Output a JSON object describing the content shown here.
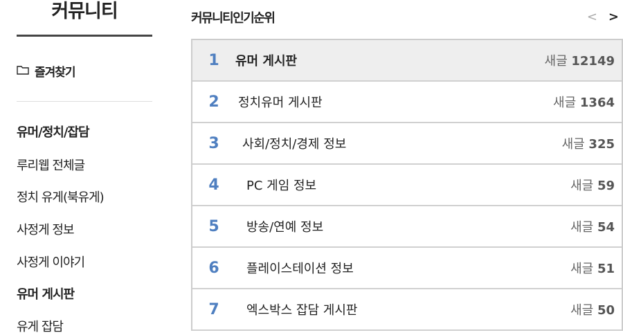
{
  "sidebar": {
    "title": "커뮤니티",
    "favorites_label": "즐겨찾기",
    "items": [
      {
        "label": "유머/정치/잡담",
        "bold": true
      },
      {
        "label": "루리웹 전체글",
        "bold": false
      },
      {
        "label": "정치 유게(북유게)",
        "bold": false
      },
      {
        "label": "사정게 정보",
        "bold": false
      },
      {
        "label": "사정게 이야기",
        "bold": false
      },
      {
        "label": "유머 게시판",
        "bold": true
      },
      {
        "label": "유게 잡담",
        "bold": false
      }
    ]
  },
  "main": {
    "title": "커뮤니티인기순위",
    "pager": {
      "prev": "<",
      "next": ">"
    },
    "count_prefix": "새글",
    "rankings": [
      {
        "rank": "1",
        "name": "유머 게시판",
        "count": "12149"
      },
      {
        "rank": "2",
        "name": "정치유머 게시판",
        "count": "1364"
      },
      {
        "rank": "3",
        "name": "사회/정치/경제 정보",
        "count": "325"
      },
      {
        "rank": "4",
        "name": "PC 게임 정보",
        "count": "59"
      },
      {
        "rank": "5",
        "name": "방송/연예 정보",
        "count": "54"
      },
      {
        "rank": "6",
        "name": "플레이스테이션 정보",
        "count": "51"
      },
      {
        "rank": "7",
        "name": "엑스박스 잡담 게시판",
        "count": "50"
      }
    ]
  },
  "colors": {
    "rank_number": "#4f7fc0",
    "top_row_bg": "#eeeeee",
    "border": "#cccccc"
  }
}
